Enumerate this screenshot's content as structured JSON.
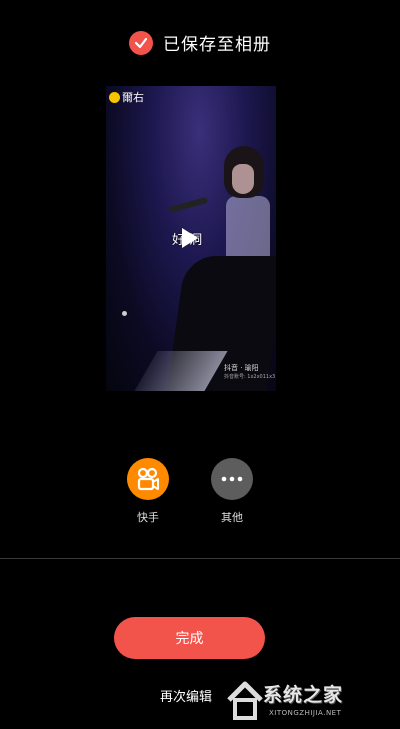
{
  "header": {
    "saved_text": "已保存至相册"
  },
  "video": {
    "badge_text": "爾右",
    "caption": "好    洞",
    "tiktok_label": "抖音 · 瑜阳",
    "tiktok_id": "抖音账号: 1x2x011x3"
  },
  "share": {
    "items": [
      {
        "label": "快手",
        "icon": "kuaishou-icon",
        "color": "#ff8a00"
      },
      {
        "label": "其他",
        "icon": "more-icon",
        "color": "#5d5d5d"
      }
    ]
  },
  "actions": {
    "done_label": "完成",
    "reedit_label": "再次编辑"
  },
  "watermark": {
    "title": "系统之家",
    "url": "XITONGZHIJIA.NET"
  },
  "colors": {
    "accent": "#f2534b",
    "background": "#000000"
  }
}
